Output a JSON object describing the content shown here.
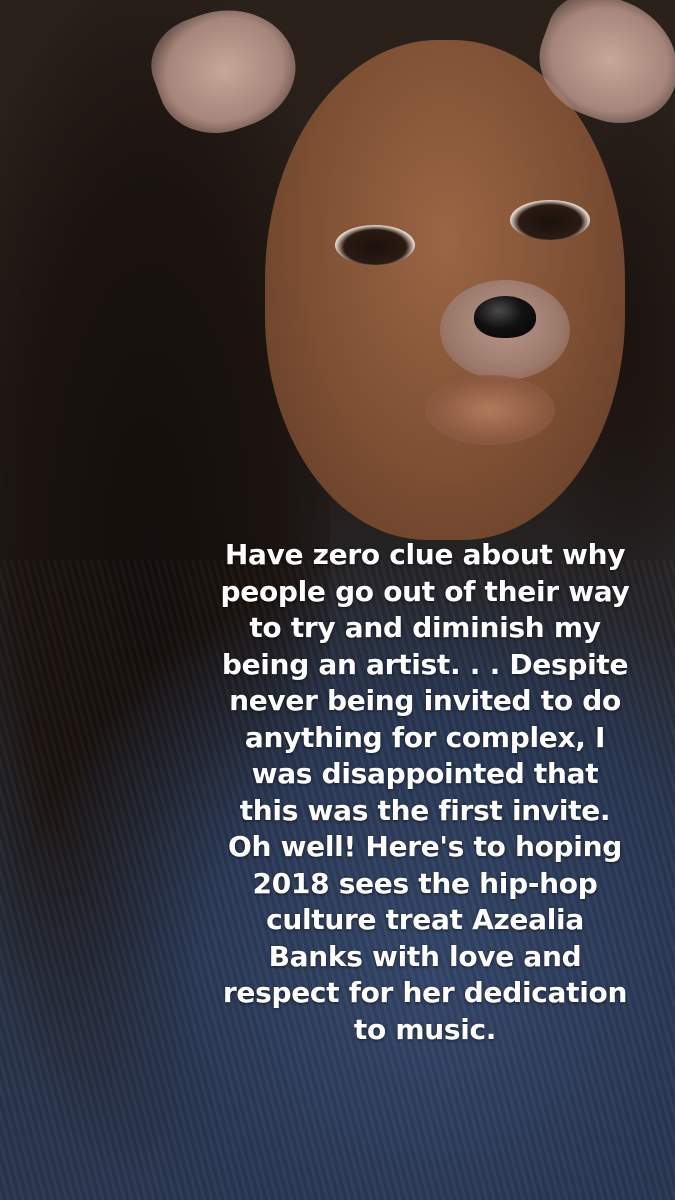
{
  "story": {
    "caption_lines": [
      "Have zero clue about why",
      "people go out of their way",
      "to try and diminish my",
      "being an artist. . . Despite",
      "never being invited to do",
      "anything for complex, I",
      "was disappointed that",
      "this was the first invite.",
      "Oh well! Here's to hoping",
      "2018 sees the hip-hop",
      "culture treat Azealia",
      "Banks with love and",
      "respect for her dedication",
      "to music."
    ],
    "caption_color": "#ffffff",
    "filter_icon": "dog-ears-filter-icon"
  }
}
